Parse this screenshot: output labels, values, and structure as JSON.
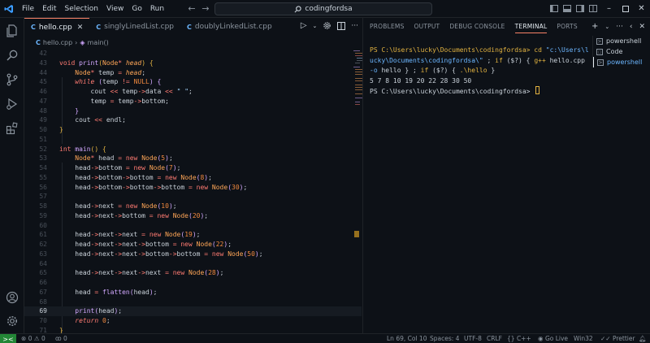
{
  "titlebar": {
    "menu": [
      "File",
      "Edit",
      "Selection",
      "View",
      "Go",
      "Run"
    ],
    "search": "codingfordsa",
    "more_label": "···"
  },
  "editor": {
    "tabs": [
      {
        "label": "hello.cpp",
        "icon": "C",
        "active": true
      },
      {
        "label": "singlyLinedList.cpp",
        "icon": "C",
        "active": false
      },
      {
        "label": "doublyLinkedList.cpp",
        "icon": "C",
        "active": false
      }
    ],
    "breadcrumb": {
      "file": "hello.cpp",
      "sep": "›",
      "symbol": "main()"
    },
    "current_line": 69,
    "lines": [
      {
        "n": "42",
        "html": ""
      },
      {
        "n": "43",
        "html": "<span class=\"kw\">void</span> <span class=\"fn\">print</span><span class=\"br1\">(</span><span class=\"ty\">Node</span><span class=\"kw\">*</span> <span class=\"var-it\">head</span><span class=\"br1\">)</span> <span class=\"br1\">{</span>"
      },
      {
        "n": "44",
        "html": "    <span class=\"ty\">Node</span><span class=\"kw\">*</span> temp <span class=\"kw\">=</span> <span class=\"var-it\">head</span>;"
      },
      {
        "n": "45",
        "html": "    <span class=\"kw2\">while</span> <span class=\"br2\">(</span>temp <span class=\"kw\">!=</span> <span class=\"num\">NULL</span><span class=\"br2\">)</span> <span class=\"br2\">{</span>"
      },
      {
        "n": "46",
        "html": "        cout <span class=\"kw\">&lt;&lt;</span> temp<span class=\"kw\">-&gt;</span>data <span class=\"kw\">&lt;&lt;</span> <span class=\"str\">\" \"</span>;"
      },
      {
        "n": "47",
        "html": "        temp <span class=\"kw\">=</span> temp<span class=\"kw\">-&gt;</span>bottom;"
      },
      {
        "n": "48",
        "html": "    <span class=\"br2\">}</span>"
      },
      {
        "n": "49",
        "html": "    cout <span class=\"kw\">&lt;&lt;</span> endl;"
      },
      {
        "n": "50",
        "html": "<span class=\"br1\">}</span>"
      },
      {
        "n": "51",
        "html": ""
      },
      {
        "n": "52",
        "html": "<span class=\"kw\">int</span> <span class=\"fn\">main</span><span class=\"br1\">()</span> <span class=\"br1\">{</span>"
      },
      {
        "n": "53",
        "html": "    <span class=\"ty\">Node</span><span class=\"kw\">*</span> head <span class=\"kw\">=</span> <span class=\"kw\">new</span> <span class=\"ty\">Node</span><span class=\"br2\">(</span><span class=\"num\">5</span><span class=\"br2\">)</span>;"
      },
      {
        "n": "54",
        "html": "    head<span class=\"kw\">-&gt;</span>bottom <span class=\"kw\">=</span> <span class=\"kw\">new</span> <span class=\"ty\">Node</span><span class=\"br2\">(</span><span class=\"num\">7</span><span class=\"br2\">)</span>;"
      },
      {
        "n": "55",
        "html": "    head<span class=\"kw\">-&gt;</span>bottom<span class=\"kw\">-&gt;</span>bottom <span class=\"kw\">=</span> <span class=\"kw\">new</span> <span class=\"ty\">Node</span><span class=\"br2\">(</span><span class=\"num\">8</span><span class=\"br2\">)</span>;"
      },
      {
        "n": "56",
        "html": "    head<span class=\"kw\">-&gt;</span>bottom<span class=\"kw\">-&gt;</span>bottom<span class=\"kw\">-&gt;</span>bottom <span class=\"kw\">=</span> <span class=\"kw\">new</span> <span class=\"ty\">Node</span><span class=\"br2\">(</span><span class=\"num\">30</span><span class=\"br2\">)</span>;"
      },
      {
        "n": "57",
        "html": ""
      },
      {
        "n": "58",
        "html": "    head<span class=\"kw\">-&gt;</span>next <span class=\"kw\">=</span> <span class=\"kw\">new</span> <span class=\"ty\">Node</span><span class=\"br2\">(</span><span class=\"num\">10</span><span class=\"br2\">)</span>;"
      },
      {
        "n": "59",
        "html": "    head<span class=\"kw\">-&gt;</span>next<span class=\"kw\">-&gt;</span>bottom <span class=\"kw\">=</span> <span class=\"kw\">new</span> <span class=\"ty\">Node</span><span class=\"br2\">(</span><span class=\"num\">20</span><span class=\"br2\">)</span>;"
      },
      {
        "n": "60",
        "html": ""
      },
      {
        "n": "61",
        "html": "    head<span class=\"kw\">-&gt;</span>next<span class=\"kw\">-&gt;</span>next <span class=\"kw\">=</span> <span class=\"kw\">new</span> <span class=\"ty\">Node</span><span class=\"br2\">(</span><span class=\"num\">19</span><span class=\"br2\">)</span>;"
      },
      {
        "n": "62",
        "html": "    head<span class=\"kw\">-&gt;</span>next<span class=\"kw\">-&gt;</span>next<span class=\"kw\">-&gt;</span>bottom <span class=\"kw\">=</span> <span class=\"kw\">new</span> <span class=\"ty\">Node</span><span class=\"br2\">(</span><span class=\"num\">22</span><span class=\"br2\">)</span>;"
      },
      {
        "n": "63",
        "html": "    head<span class=\"kw\">-&gt;</span>next<span class=\"kw\">-&gt;</span>next<span class=\"kw\">-&gt;</span>bottom<span class=\"kw\">-&gt;</span>bottom <span class=\"kw\">=</span> <span class=\"kw\">new</span> <span class=\"ty\">Node</span><span class=\"br2\">(</span><span class=\"num\">50</span><span class=\"br2\">)</span>;"
      },
      {
        "n": "64",
        "html": ""
      },
      {
        "n": "65",
        "html": "    head<span class=\"kw\">-&gt;</span>next<span class=\"kw\">-&gt;</span>next<span class=\"kw\">-&gt;</span>next <span class=\"kw\">=</span> <span class=\"kw\">new</span> <span class=\"ty\">Node</span><span class=\"br2\">(</span><span class=\"num\">28</span><span class=\"br2\">)</span>;"
      },
      {
        "n": "66",
        "html": ""
      },
      {
        "n": "67",
        "html": "    head <span class=\"kw\">=</span> <span class=\"fn\">flatten</span><span class=\"br2\">(</span>head<span class=\"br2\">)</span>;"
      },
      {
        "n": "68",
        "html": ""
      },
      {
        "n": "69",
        "html": "    <span class=\"fn\">print</span><span class=\"br2\">(</span>head<span class=\"br2\">)</span>;"
      },
      {
        "n": "70",
        "html": "    <span class=\"kw2\">return</span> <span class=\"num\">0</span>;"
      },
      {
        "n": "71",
        "html": "<span class=\"br1\">}</span>"
      }
    ]
  },
  "panel": {
    "tabs": [
      {
        "label": "PROBLEMS",
        "active": false
      },
      {
        "label": "OUTPUT",
        "active": false
      },
      {
        "label": "DEBUG CONSOLE",
        "active": false
      },
      {
        "label": "TERMINAL",
        "active": true
      },
      {
        "label": "PORTS",
        "active": false
      }
    ],
    "terminal_lines": [
      "<span class=\"t-yel\">PS C:\\Users\\lucky\\Documents\\codingfordsa&gt; </span><span class=\"t-yel\">cd</span> <span class=\"t-blue\">\"c:\\Users\\l</span>",
      "<span class=\"t-blue\">ucky\\Documents\\codingfordsa\\\"</span> ; <span class=\"t-yel\">if</span> ($?) { <span class=\"t-yel\">g++</span> hello.cpp",
      "<span class=\"t-blue\">-o</span> hello } ; <span class=\"t-yel\">if</span> ($?) { <span class=\"t-yel\">.\\hello</span> }",
      "5 7 8 10 19 20 22 28 30 50",
      "PS C:\\Users\\lucky\\Documents\\codingfordsa&gt; <span class=\"cursor\"></span>"
    ],
    "terminals": [
      {
        "label": "powershell",
        "icon": ">",
        "active": false
      },
      {
        "label": "Code",
        "icon": "☐",
        "active": false
      },
      {
        "label": "powershell",
        "icon": ">",
        "active": true
      }
    ]
  },
  "statusbar": {
    "remote": "><",
    "errors": "0",
    "warnings": "0",
    "info": "0",
    "position": "Ln 69, Col 10",
    "spaces": "Spaces: 4",
    "encoding": "UTF-8",
    "eol": "CRLF",
    "language": "C++",
    "golive": "Go Live",
    "platform": "Win32",
    "prettier": "Prettier"
  },
  "colors": {
    "accent": "#f78166",
    "remote_bg": "#238636",
    "background": "#0d1117"
  }
}
